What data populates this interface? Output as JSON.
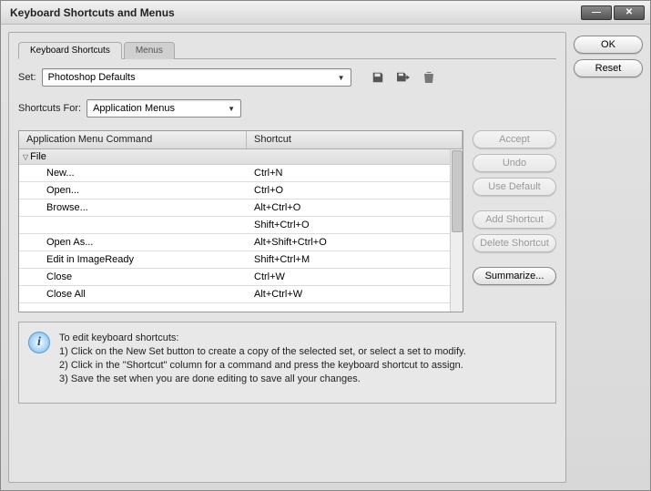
{
  "window": {
    "title": "Keyboard Shortcuts and Menus"
  },
  "tabs": {
    "shortcuts": "Keyboard Shortcuts",
    "menus": "Menus"
  },
  "set": {
    "label": "Set:",
    "value": "Photoshop Defaults"
  },
  "shortcuts_for": {
    "label": "Shortcuts For:",
    "value": "Application Menus"
  },
  "table": {
    "headers": {
      "command": "Application Menu Command",
      "shortcut": "Shortcut"
    },
    "group": "File",
    "rows": [
      {
        "cmd": "New...",
        "sc": "Ctrl+N"
      },
      {
        "cmd": "Open...",
        "sc": "Ctrl+O"
      },
      {
        "cmd": "Browse...",
        "sc": "Alt+Ctrl+O"
      },
      {
        "cmd": "",
        "sc": "Shift+Ctrl+O"
      },
      {
        "cmd": "Open As...",
        "sc": "Alt+Shift+Ctrl+O"
      },
      {
        "cmd": "Edit in ImageReady",
        "sc": "Shift+Ctrl+M"
      },
      {
        "cmd": "Close",
        "sc": "Ctrl+W"
      },
      {
        "cmd": "Close All",
        "sc": "Alt+Ctrl+W"
      }
    ]
  },
  "hint": {
    "title": "To edit keyboard shortcuts:",
    "l1": "1) Click on the New Set button to create a copy of the selected set, or select a set to modify.",
    "l2": "2) Click in the \"Shortcut\" column for a command and press the keyboard shortcut to assign.",
    "l3": "3) Save the set when you are done editing to save all your changes."
  },
  "buttons": {
    "ok": "OK",
    "reset": "Reset",
    "accept": "Accept",
    "undo": "Undo",
    "use_default": "Use Default",
    "add_shortcut": "Add Shortcut",
    "delete_shortcut": "Delete Shortcut",
    "summarize": "Summarize..."
  }
}
